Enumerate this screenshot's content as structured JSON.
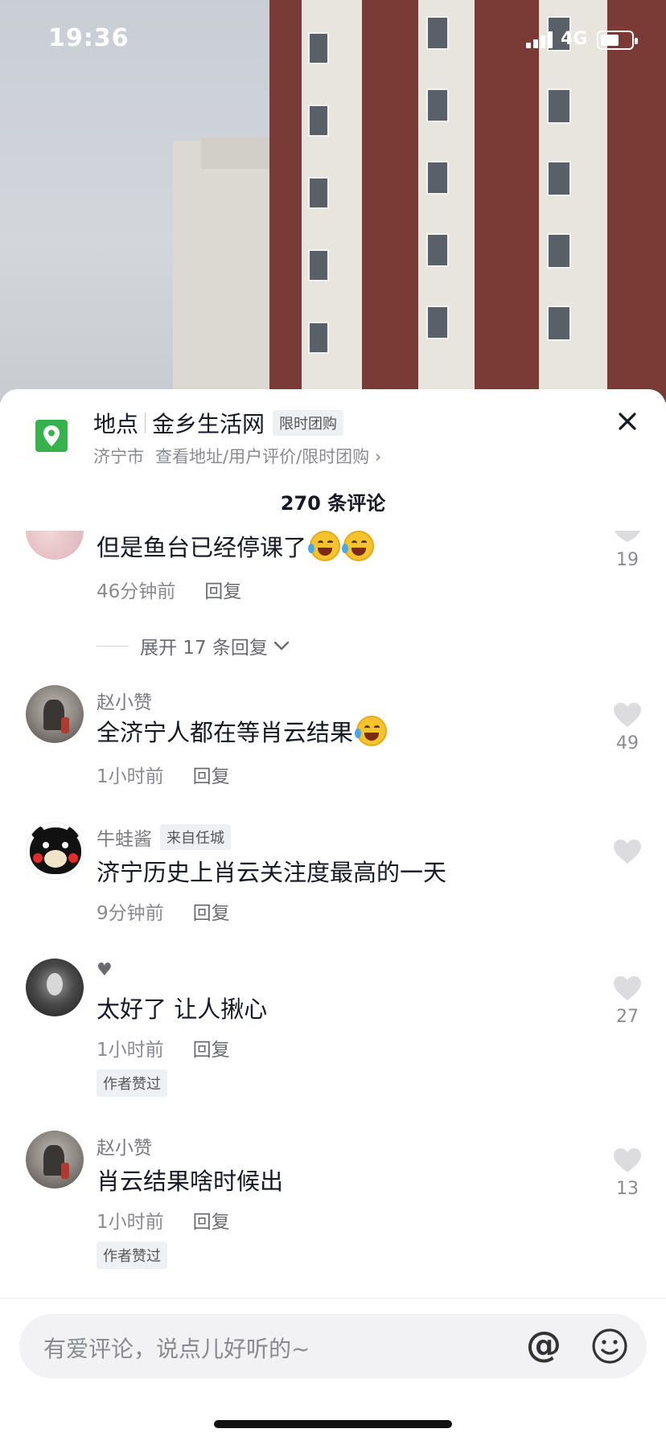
{
  "status_bar": {
    "time": "19:36",
    "network": "4G"
  },
  "location": {
    "prefix": "地点",
    "name": "金乡生活网",
    "tag": "限时团购",
    "city": "济宁市",
    "link": "查看地址/用户评价/限时团购 ›"
  },
  "comment_count": "270 条评论",
  "comments": [
    {
      "text": "但是鱼台已经停课了",
      "time": "46分钟前",
      "reply": "回复",
      "likes": "19"
    },
    {
      "name": "赵小赞",
      "text": "全济宁人都在等肖云结果",
      "time": "1小时前",
      "reply": "回复",
      "likes": "49"
    },
    {
      "name": "牛蛙酱",
      "from": "来自任城",
      "text": "济宁历史上肖云关注度最高的一天",
      "time": "9分钟前",
      "reply": "回复",
      "likes": ""
    },
    {
      "name": "♥",
      "text": "太好了  让人揪心",
      "time": "1小时前",
      "reply": "回复",
      "likes": "27",
      "author_tag": "作者赞过"
    },
    {
      "name": "赵小赞",
      "text": "肖云结果啥时候出",
      "time": "1小时前",
      "reply": "回复",
      "likes": "13",
      "author_tag": "作者赞过"
    }
  ],
  "expand_replies": "展开 17 条回复",
  "input": {
    "placeholder": "有爱评论，说点儿好听的~",
    "at": "@"
  },
  "colors": {
    "location_icon": "#37b24d",
    "accent_text": "#161823"
  }
}
